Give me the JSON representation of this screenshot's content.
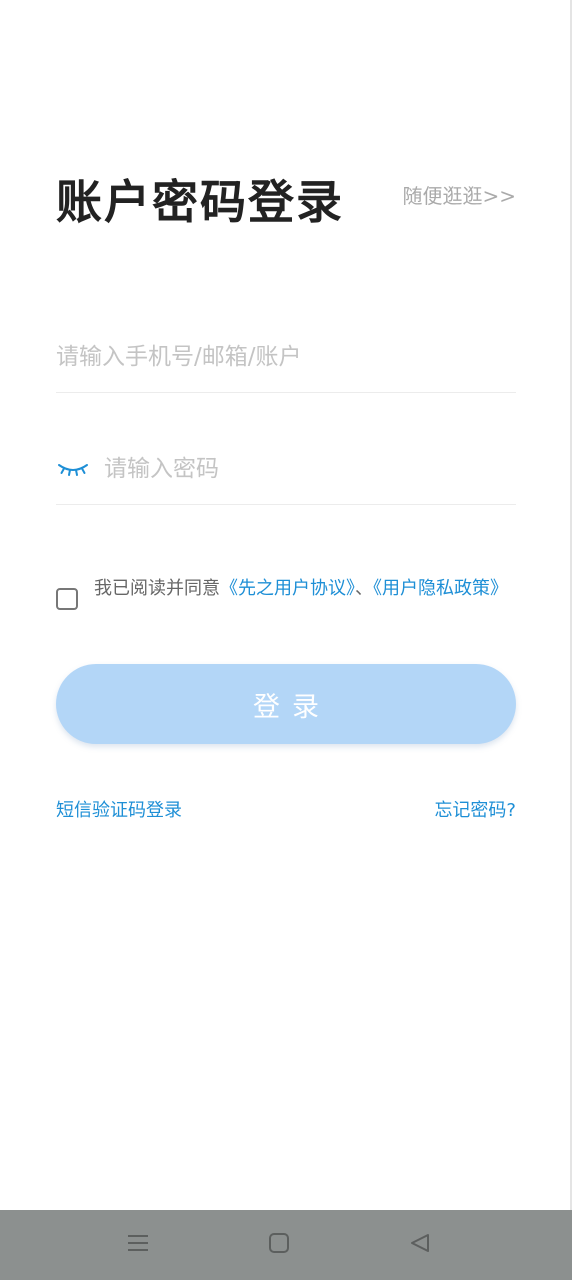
{
  "header": {
    "title": "账户密码登录",
    "browse_label": "随便逛逛>>"
  },
  "form": {
    "account_placeholder": "请输入手机号/邮箱/账户",
    "password_placeholder": "请输入密码",
    "password_toggle_icon": "eye-closed-icon"
  },
  "agreement": {
    "checked": false,
    "prefix": "我已阅读并同意",
    "user_agreement": "《先之用户协议》",
    "separator": "、",
    "privacy_policy": "《用户隐私政策》"
  },
  "actions": {
    "login_label": "登录",
    "sms_login_label": "短信验证码登录",
    "forgot_password_label": "忘记密码?"
  },
  "navbar": {
    "menu_icon": "menu-icon",
    "home_icon": "home-square-icon",
    "back_icon": "back-triangle-icon"
  },
  "colors": {
    "accent": "#1e8fd6",
    "button_disabled": "#b3d6f7",
    "title": "#222222",
    "placeholder": "#c4c4c4",
    "navbar": "#8c908f"
  }
}
